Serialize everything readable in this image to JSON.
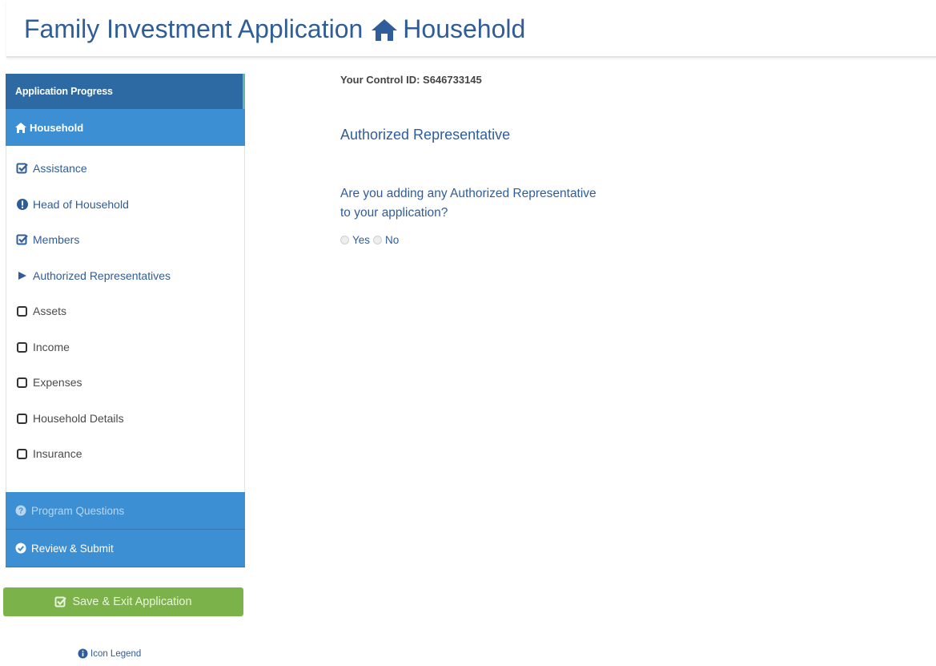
{
  "header": {
    "title": "Family Investment Application",
    "section": "Household"
  },
  "sidebar": {
    "heading": "Application Progress",
    "active": "Household",
    "items": [
      {
        "label": "Assistance",
        "icon": "checked-box-icon"
      },
      {
        "label": "Head of Household",
        "icon": "exclamation-circle-icon"
      },
      {
        "label": "Members",
        "icon": "checked-box-icon"
      },
      {
        "label": "Authorized Representatives",
        "icon": "play-arrow-icon"
      },
      {
        "label": "Assets",
        "icon": "empty-box-icon"
      },
      {
        "label": "Income",
        "icon": "empty-box-icon"
      },
      {
        "label": "Expenses",
        "icon": "empty-box-icon"
      },
      {
        "label": "Household Details",
        "icon": "empty-box-icon"
      },
      {
        "label": "Insurance",
        "icon": "empty-box-icon"
      }
    ],
    "program_questions": "Program Questions",
    "review_submit": "Review & Submit"
  },
  "actions": {
    "save_exit": "Save & Exit Application",
    "icon_legend": "Icon Legend"
  },
  "main": {
    "control_id": "Your Control ID: S646733145",
    "section_title": "Authorized Representative",
    "question": "Are you adding any Authorized Representative to your application?",
    "options": [
      "Yes",
      "No"
    ]
  },
  "colors": {
    "brand_blue": "#2f5d9a",
    "sidebar_header": "#2d69a3",
    "sidebar_active": "#3d8fd3",
    "save_green": "#7bb24a"
  }
}
